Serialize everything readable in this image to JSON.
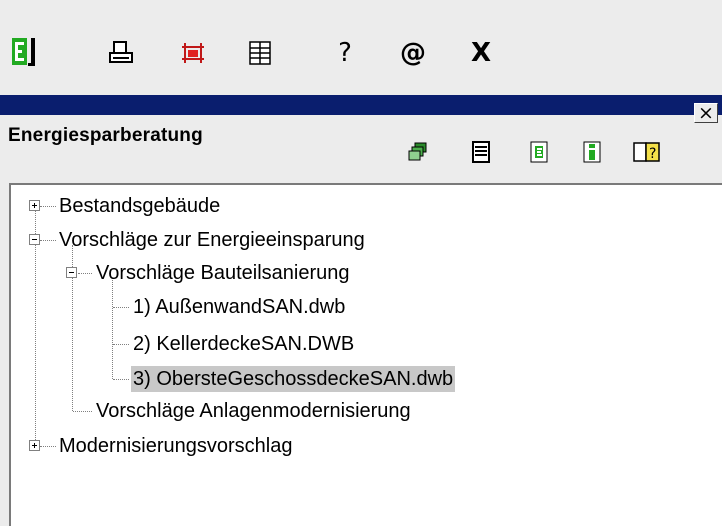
{
  "toolbar": {
    "items": [
      {
        "name": "logo-e-icon",
        "icon": "green-e-logo"
      },
      {
        "name": "print-icon",
        "icon": "printer",
        "glyph": "⎙"
      },
      {
        "name": "grid-select-icon",
        "icon": "red-grid"
      },
      {
        "name": "table-icon",
        "icon": "table-grid"
      },
      {
        "name": "help-icon",
        "icon": "question",
        "glyph": "?"
      },
      {
        "name": "at-icon",
        "icon": "at-sign",
        "glyph": "@"
      },
      {
        "name": "close-icon",
        "icon": "x",
        "glyph": "X"
      }
    ]
  },
  "panel": {
    "title": "Energiesparberatung",
    "close_glyph": "×",
    "tools": [
      "stack-icon",
      "list-icon",
      "document-e-icon",
      "info-icon",
      "book-icon"
    ]
  },
  "tree": {
    "nodes": [
      {
        "label": "Bestandsgebäude",
        "level": 0,
        "expander": "plus"
      },
      {
        "label": "Vorschläge zur Energieeinsparung",
        "level": 0,
        "expander": "minus"
      },
      {
        "label": "Vorschläge Bauteilsanierung",
        "level": 1,
        "expander": "minus"
      },
      {
        "label": "1) AußenwandSAN.dwb",
        "level": 2,
        "expander": "none"
      },
      {
        "label": "2) KellerdeckeSAN.DWB",
        "level": 2,
        "expander": "none"
      },
      {
        "label": "3) ObersteGeschossdeckeSAN.dwb",
        "level": 2,
        "expander": "none",
        "selected": true
      },
      {
        "label": "Vorschläge Anlagenmodernisierung",
        "level": 1,
        "expander": "none"
      },
      {
        "label": "Modernisierungsvorschlag",
        "level": 0,
        "expander": "plus"
      }
    ]
  },
  "colors": {
    "title_bar": "#0a1e6e",
    "selection": "#c8c8c8",
    "logo_green": "#22aa22"
  }
}
